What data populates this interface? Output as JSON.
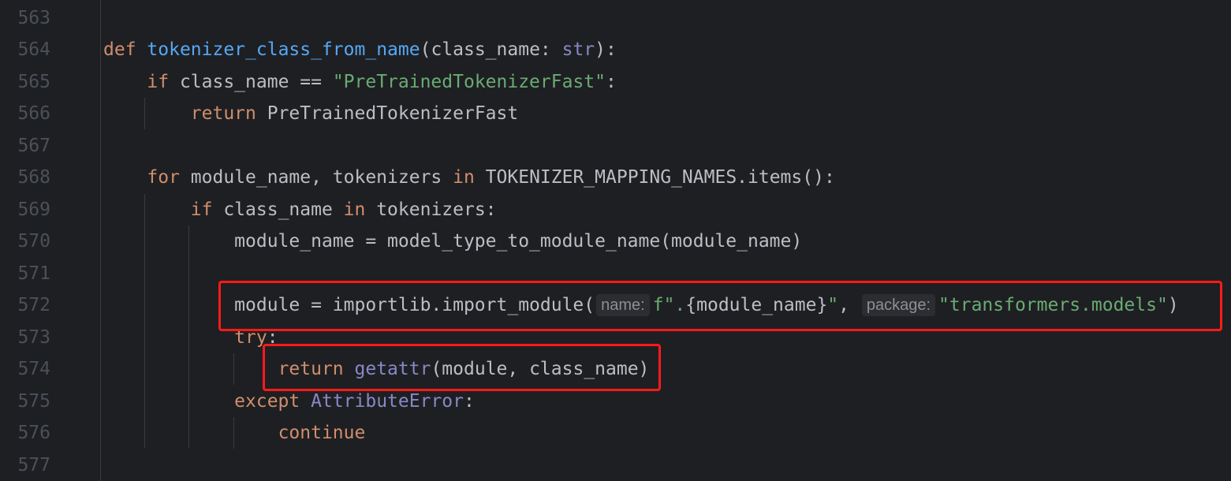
{
  "editor": {
    "language": "python",
    "lines": [
      {
        "number": "563",
        "text": ""
      },
      {
        "number": "564",
        "text": "def tokenizer_class_from_name(class_name: str):"
      },
      {
        "number": "565",
        "text": "    if class_name == \"PreTrainedTokenizerFast\":"
      },
      {
        "number": "566",
        "text": "        return PreTrainedTokenizerFast"
      },
      {
        "number": "567",
        "text": ""
      },
      {
        "number": "568",
        "text": "    for module_name, tokenizers in TOKENIZER_MAPPING_NAMES.items():"
      },
      {
        "number": "569",
        "text": "        if class_name in tokenizers:"
      },
      {
        "number": "570",
        "text": "            module_name = model_type_to_module_name(module_name)"
      },
      {
        "number": "571",
        "text": ""
      },
      {
        "number": "572",
        "text": "            module = importlib.import_module(f\".{module_name}\", \"transformers.models\")"
      },
      {
        "number": "573",
        "text": "            try:"
      },
      {
        "number": "574",
        "text": "                return getattr(module, class_name)"
      },
      {
        "number": "575",
        "text": "            except AttributeError:"
      },
      {
        "number": "576",
        "text": "                continue"
      },
      {
        "number": "577",
        "text": ""
      }
    ],
    "parameter_hints": {
      "name": "name:",
      "package": "package:"
    },
    "highlights": [
      {
        "line": "572",
        "description": "importlib.import_module call"
      },
      {
        "line": "574",
        "description": "return getattr(module, class_name)"
      }
    ],
    "colors": {
      "background": "#1e1f22",
      "keyword": "#cf8e6d",
      "function": "#56a8f5",
      "string": "#6aab73",
      "builtin": "#8888c6",
      "text": "#bcbec4",
      "line_number": "#4b5059",
      "highlight_box": "#ff1a1a"
    }
  }
}
